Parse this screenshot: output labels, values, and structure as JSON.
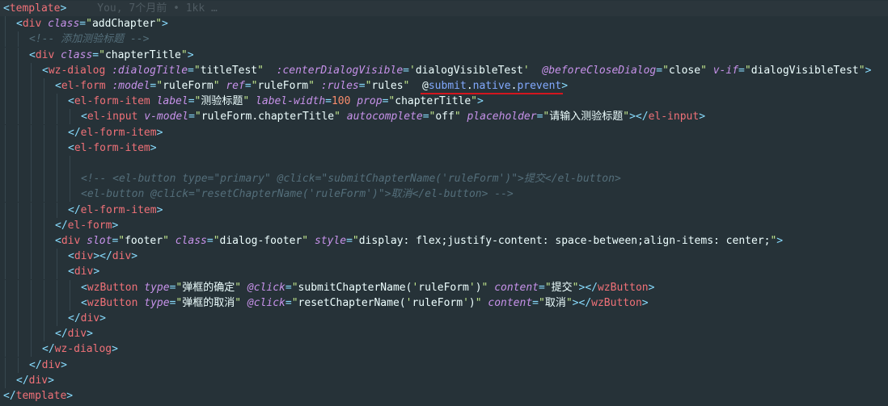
{
  "blame": "You, 7个月前 • 1kk …",
  "lines": [
    {
      "indent": 0,
      "current": true,
      "tokens": [
        [
          "p",
          "<"
        ],
        [
          "t",
          "template"
        ],
        [
          "p",
          ">"
        ]
      ]
    },
    {
      "indent": 1,
      "tokens": [
        [
          "p",
          "<"
        ],
        [
          "t",
          "div"
        ],
        [
          "s",
          " "
        ],
        [
          "ai",
          "class"
        ],
        [
          "p",
          "="
        ],
        [
          "q",
          "\""
        ],
        [
          "v",
          "addChapter"
        ],
        [
          "q",
          "\""
        ],
        [
          "p",
          ">"
        ]
      ]
    },
    {
      "indent": 2,
      "tokens": [
        [
          "c",
          "<!-- 添加测验标题 -->"
        ]
      ]
    },
    {
      "indent": 2,
      "tokens": [
        [
          "p",
          "<"
        ],
        [
          "t",
          "div"
        ],
        [
          "s",
          " "
        ],
        [
          "ai",
          "class"
        ],
        [
          "p",
          "="
        ],
        [
          "q",
          "\""
        ],
        [
          "v",
          "chapterTitle"
        ],
        [
          "q",
          "\""
        ],
        [
          "p",
          ">"
        ]
      ]
    },
    {
      "indent": 3,
      "tokens": [
        [
          "p",
          "<"
        ],
        [
          "t",
          "wz-dialog"
        ],
        [
          "s",
          " "
        ],
        [
          "ai",
          ":dialogTitle"
        ],
        [
          "p",
          "="
        ],
        [
          "q",
          "\""
        ],
        [
          "v",
          "titleTest"
        ],
        [
          "q",
          "\""
        ],
        [
          "s",
          "  "
        ],
        [
          "ai",
          ":centerDialogVisible"
        ],
        [
          "p",
          "="
        ],
        [
          "q",
          "'"
        ],
        [
          "v",
          "dialogVisibleTest"
        ],
        [
          "q",
          "'"
        ],
        [
          "s",
          "  "
        ],
        [
          "ai",
          "@beforeCloseDialog"
        ],
        [
          "p",
          "="
        ],
        [
          "q",
          "\""
        ],
        [
          "v",
          "close"
        ],
        [
          "q",
          "\""
        ],
        [
          "s",
          " "
        ],
        [
          "ai",
          "v-if"
        ],
        [
          "p",
          "="
        ],
        [
          "q",
          "\""
        ],
        [
          "v",
          "dialogVisibleTest"
        ],
        [
          "q",
          "\""
        ],
        [
          "p",
          ">"
        ]
      ]
    },
    {
      "indent": 4,
      "tokens": [
        [
          "p",
          "<"
        ],
        [
          "t",
          "el-form"
        ],
        [
          "s",
          " "
        ],
        [
          "ai",
          ":model"
        ],
        [
          "p",
          "="
        ],
        [
          "q",
          "\""
        ],
        [
          "v",
          "ruleForm"
        ],
        [
          "q",
          "\""
        ],
        [
          "s",
          " "
        ],
        [
          "ai",
          "ref"
        ],
        [
          "p",
          "="
        ],
        [
          "q",
          "\""
        ],
        [
          "v",
          "ruleForm"
        ],
        [
          "q",
          "\""
        ],
        [
          "s",
          " "
        ],
        [
          "ai",
          ":rules"
        ],
        [
          "p",
          "="
        ],
        [
          "q",
          "\""
        ],
        [
          "v",
          "rules"
        ],
        [
          "q",
          "\""
        ],
        [
          "s",
          "  "
        ],
        [
          "ev",
          "@"
        ],
        [
          "em",
          "submit"
        ],
        [
          "ev",
          "."
        ],
        [
          "em",
          "native"
        ],
        [
          "ev",
          "."
        ],
        [
          "em",
          "prevent"
        ],
        [
          "p",
          ">"
        ]
      ]
    },
    {
      "indent": 5,
      "tokens": [
        [
          "p",
          "<"
        ],
        [
          "t",
          "el-form-item"
        ],
        [
          "s",
          " "
        ],
        [
          "ai",
          "label"
        ],
        [
          "p",
          "="
        ],
        [
          "q",
          "\""
        ],
        [
          "v",
          "测验标题"
        ],
        [
          "q",
          "\""
        ],
        [
          "s",
          " "
        ],
        [
          "ai",
          "label-width"
        ],
        [
          "p",
          "="
        ],
        [
          "n",
          "100"
        ],
        [
          "s",
          " "
        ],
        [
          "ai",
          "prop"
        ],
        [
          "p",
          "="
        ],
        [
          "q",
          "\""
        ],
        [
          "v",
          "chapterTitle"
        ],
        [
          "q",
          "\""
        ],
        [
          "p",
          ">"
        ]
      ]
    },
    {
      "indent": 6,
      "tokens": [
        [
          "p",
          "<"
        ],
        [
          "t",
          "el-input"
        ],
        [
          "s",
          " "
        ],
        [
          "ai",
          "v-model"
        ],
        [
          "p",
          "="
        ],
        [
          "q",
          "\""
        ],
        [
          "v",
          "ruleForm.chapterTitle"
        ],
        [
          "q",
          "\""
        ],
        [
          "s",
          " "
        ],
        [
          "ai",
          "autocomplete"
        ],
        [
          "p",
          "="
        ],
        [
          "q",
          "\""
        ],
        [
          "v",
          "off"
        ],
        [
          "q",
          "\""
        ],
        [
          "s",
          " "
        ],
        [
          "ai",
          "placeholder"
        ],
        [
          "p",
          "="
        ],
        [
          "q",
          "\""
        ],
        [
          "v",
          "请输入测验标题"
        ],
        [
          "q",
          "\""
        ],
        [
          "p",
          "></"
        ],
        [
          "t",
          "el-input"
        ],
        [
          "p",
          ">"
        ]
      ]
    },
    {
      "indent": 5,
      "tokens": [
        [
          "p",
          "</"
        ],
        [
          "t",
          "el-form-item"
        ],
        [
          "p",
          ">"
        ]
      ]
    },
    {
      "indent": 5,
      "tokens": [
        [
          "p",
          "<"
        ],
        [
          "t",
          "el-form-item"
        ],
        [
          "p",
          ">"
        ]
      ]
    },
    {
      "indent": 6,
      "tokens": []
    },
    {
      "indent": 6,
      "tokens": [
        [
          "c",
          "<!-- <el-button type=\"primary\" @click=\"submitChapterName('ruleForm')\">提交</el-button>"
        ]
      ]
    },
    {
      "indent": 6,
      "tokens": [
        [
          "c",
          "<el-button @click=\"resetChapterName('ruleForm')\">取消</el-button> -->"
        ]
      ]
    },
    {
      "indent": 5,
      "tokens": [
        [
          "p",
          "</"
        ],
        [
          "t",
          "el-form-item"
        ],
        [
          "p",
          ">"
        ]
      ]
    },
    {
      "indent": 4,
      "tokens": [
        [
          "p",
          "</"
        ],
        [
          "t",
          "el-form"
        ],
        [
          "p",
          ">"
        ]
      ]
    },
    {
      "indent": 4,
      "tokens": [
        [
          "p",
          "<"
        ],
        [
          "t",
          "div"
        ],
        [
          "s",
          " "
        ],
        [
          "ai",
          "slot"
        ],
        [
          "p",
          "="
        ],
        [
          "q",
          "\""
        ],
        [
          "v",
          "footer"
        ],
        [
          "q",
          "\""
        ],
        [
          "s",
          " "
        ],
        [
          "ai",
          "class"
        ],
        [
          "p",
          "="
        ],
        [
          "q",
          "\""
        ],
        [
          "v",
          "dialog-footer"
        ],
        [
          "q",
          "\""
        ],
        [
          "s",
          " "
        ],
        [
          "ai",
          "style"
        ],
        [
          "p",
          "="
        ],
        [
          "q",
          "\""
        ],
        [
          "v",
          "display: flex;justify-content: space-between;align-items: center;"
        ],
        [
          "q",
          "\""
        ],
        [
          "p",
          ">"
        ]
      ]
    },
    {
      "indent": 5,
      "tokens": [
        [
          "p",
          "<"
        ],
        [
          "t",
          "div"
        ],
        [
          "p",
          "></"
        ],
        [
          "t",
          "div"
        ],
        [
          "p",
          ">"
        ]
      ]
    },
    {
      "indent": 5,
      "tokens": [
        [
          "p",
          "<"
        ],
        [
          "t",
          "div"
        ],
        [
          "p",
          ">"
        ]
      ]
    },
    {
      "indent": 6,
      "tokens": [
        [
          "p",
          "<"
        ],
        [
          "t",
          "wzButton"
        ],
        [
          "s",
          " "
        ],
        [
          "ai",
          "type"
        ],
        [
          "p",
          "="
        ],
        [
          "q",
          "\""
        ],
        [
          "v",
          "弹框的确定"
        ],
        [
          "q",
          "\""
        ],
        [
          "s",
          " "
        ],
        [
          "ai",
          "@click"
        ],
        [
          "p",
          "="
        ],
        [
          "q",
          "\""
        ],
        [
          "v",
          "submitChapterName("
        ],
        [
          "q",
          "'"
        ],
        [
          "v",
          "ruleForm"
        ],
        [
          "q",
          "'"
        ],
        [
          "v",
          ")"
        ],
        [
          "q",
          "\""
        ],
        [
          "s",
          " "
        ],
        [
          "ai",
          "content"
        ],
        [
          "p",
          "="
        ],
        [
          "q",
          "\""
        ],
        [
          "v",
          "提交"
        ],
        [
          "q",
          "\""
        ],
        [
          "p",
          "></"
        ],
        [
          "t",
          "wzButton"
        ],
        [
          "p",
          ">"
        ]
      ]
    },
    {
      "indent": 6,
      "tokens": [
        [
          "p",
          "<"
        ],
        [
          "t",
          "wzButton"
        ],
        [
          "s",
          " "
        ],
        [
          "ai",
          "type"
        ],
        [
          "p",
          "="
        ],
        [
          "q",
          "\""
        ],
        [
          "v",
          "弹框的取消"
        ],
        [
          "q",
          "\""
        ],
        [
          "s",
          " "
        ],
        [
          "ai",
          "@click"
        ],
        [
          "p",
          "="
        ],
        [
          "q",
          "\""
        ],
        [
          "v",
          "resetChapterName("
        ],
        [
          "q",
          "'"
        ],
        [
          "v",
          "ruleForm"
        ],
        [
          "q",
          "'"
        ],
        [
          "v",
          ")"
        ],
        [
          "q",
          "\""
        ],
        [
          "s",
          " "
        ],
        [
          "ai",
          "content"
        ],
        [
          "p",
          "="
        ],
        [
          "q",
          "\""
        ],
        [
          "v",
          "取消"
        ],
        [
          "q",
          "\""
        ],
        [
          "p",
          "></"
        ],
        [
          "t",
          "wzButton"
        ],
        [
          "p",
          ">"
        ]
      ]
    },
    {
      "indent": 5,
      "tokens": [
        [
          "p",
          "</"
        ],
        [
          "t",
          "div"
        ],
        [
          "p",
          ">"
        ]
      ]
    },
    {
      "indent": 4,
      "tokens": [
        [
          "p",
          "</"
        ],
        [
          "t",
          "div"
        ],
        [
          "p",
          ">"
        ]
      ]
    },
    {
      "indent": 3,
      "tokens": [
        [
          "p",
          "</"
        ],
        [
          "t",
          "wz-dialog"
        ],
        [
          "p",
          ">"
        ]
      ]
    },
    {
      "indent": 2,
      "tokens": [
        [
          "p",
          "</"
        ],
        [
          "t",
          "div"
        ],
        [
          "p",
          ">"
        ]
      ]
    },
    {
      "indent": 1,
      "tokens": [
        [
          "p",
          "</"
        ],
        [
          "t",
          "div"
        ],
        [
          "p",
          ">"
        ]
      ]
    },
    {
      "indent": 0,
      "tokens": [
        [
          "p",
          "</"
        ],
        [
          "t",
          "template"
        ],
        [
          "p",
          ">"
        ]
      ]
    }
  ]
}
